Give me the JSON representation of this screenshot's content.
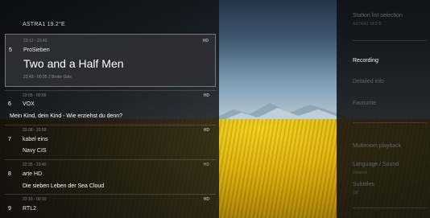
{
  "satellite": "ASTRA1 19.2°E",
  "channels": [
    {
      "number": "5",
      "name": "ProSieben",
      "time": "23:12 - 23:43",
      "programme": "Two and a Half Men",
      "subtitle": "23:43 - 00:05   2 Broke Girls",
      "badge": "HD",
      "selected": true
    },
    {
      "number": "6",
      "name": "VOX",
      "time": "23:05 - 00:00",
      "programme": "Mein Kind, dein Kind - Wie erziehst du denn?",
      "badge": "HD"
    },
    {
      "number": "7",
      "name": "kabel eins",
      "time": "23:08 - 23:59",
      "programme": "Navy CIS",
      "badge": "HD"
    },
    {
      "number": "8",
      "name": "arte HD",
      "time": "22:35 - 23:40",
      "programme": "Die sieben Leben der Sea Cloud",
      "badge": "HD"
    },
    {
      "number": "9",
      "name": "RTL2",
      "time": "23:10 - 00:10",
      "badge": "HD"
    }
  ],
  "menu": {
    "top_item": "Station list selection",
    "top_sub": "ASTRA1 19.2°E",
    "recording": "Recording",
    "detailed_info": "Detailed info",
    "favourite": "Favourite",
    "multiroom": "Multiroom playback",
    "language": "Language / Sound",
    "language_sub": "Deutsch",
    "subtitles": "Subtitles",
    "subtitles_sub": "Off"
  }
}
